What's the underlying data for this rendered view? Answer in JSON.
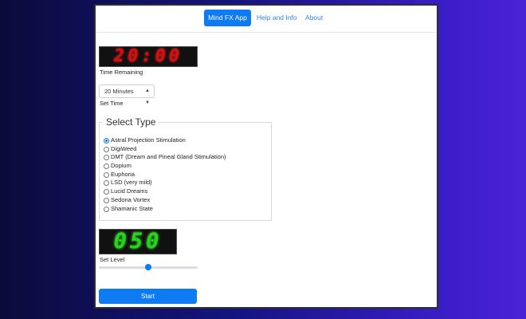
{
  "navbar": {
    "app_button": "Mind FX App",
    "help_link": "Help and Info",
    "about_link": "About"
  },
  "timer": {
    "display": "20:00",
    "label": "Time Remaining"
  },
  "set_time": {
    "selected": "20 Minutes",
    "label": "Set Time"
  },
  "select_type": {
    "legend": "Select Type",
    "selected_index": 0,
    "options": [
      "Astral Projection Stimulation",
      "DigiWeed",
      "DMT (Dream and Pineal Gland Stimulation)",
      "Dopium",
      "Euphoria",
      "LSD (very mild)",
      "Lucid Dreams",
      "Sedona Vortex",
      "Shamanic State"
    ]
  },
  "level": {
    "display": "050",
    "label": "Set Level",
    "value_fraction": 0.5
  },
  "start_button": "Start",
  "colors": {
    "accent": "#0d7bf2",
    "timer_digits": "#d31010",
    "level_digits": "#25d41b"
  }
}
